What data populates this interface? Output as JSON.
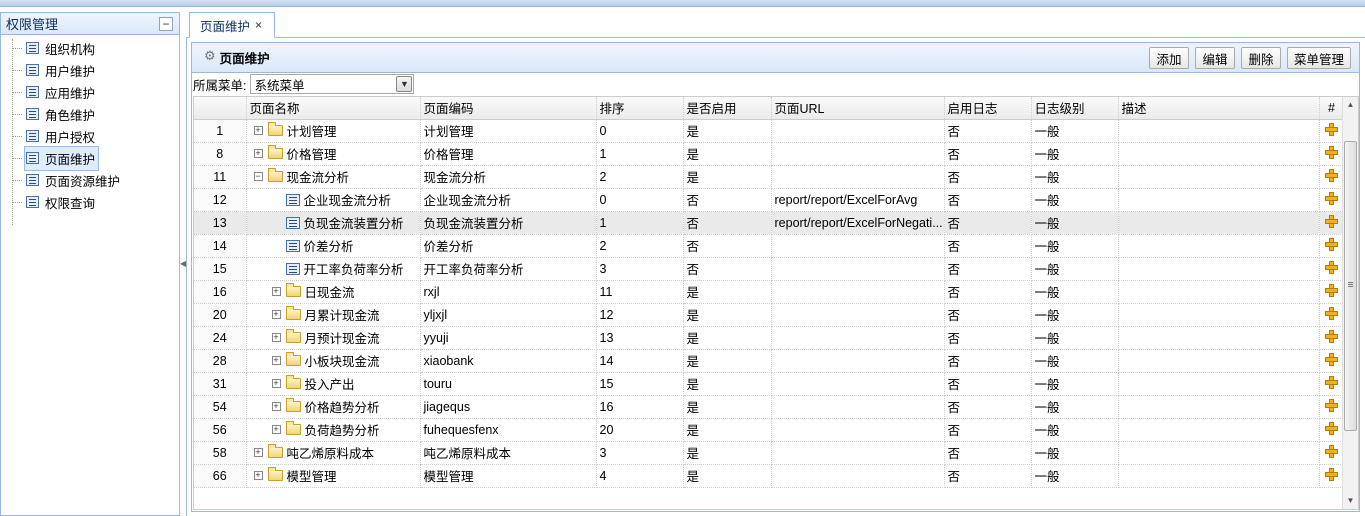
{
  "left": {
    "title": "权限管理",
    "collapse_symbol": "−",
    "items": [
      {
        "label": "组织机构"
      },
      {
        "label": "用户维护"
      },
      {
        "label": "应用维护"
      },
      {
        "label": "角色维护"
      },
      {
        "label": "用户授权"
      },
      {
        "label": "页面维护",
        "selected": true
      },
      {
        "label": "页面资源维护"
      },
      {
        "label": "权限查询"
      }
    ]
  },
  "tabs": [
    {
      "label": "页面维护",
      "close": "×"
    }
  ],
  "panel": {
    "title": "页面维护",
    "buttons": {
      "add": "添加",
      "edit": "编辑",
      "delete": "删除",
      "menu": "菜单管理"
    }
  },
  "filter": {
    "label": "所属菜单:",
    "value": "系统菜单"
  },
  "grid": {
    "columns": [
      "页面名称",
      "页面编码",
      "排序",
      "是否启用",
      "页面URL",
      "启用日志",
      "日志级别",
      "描述",
      "#"
    ],
    "rows": [
      {
        "rn": "1",
        "name": "计划管理",
        "code": "计划管理",
        "order": "0",
        "enabled": "是",
        "url": "",
        "log": "否",
        "level": "一般",
        "desc": "",
        "indent": 0,
        "kind": "folder",
        "exp": "+"
      },
      {
        "rn": "8",
        "name": "价格管理",
        "code": "价格管理",
        "order": "1",
        "enabled": "是",
        "url": "",
        "log": "否",
        "level": "一般",
        "desc": "",
        "indent": 0,
        "kind": "folder",
        "exp": "+"
      },
      {
        "rn": "11",
        "name": "现金流分析",
        "code": "现金流分析",
        "order": "2",
        "enabled": "是",
        "url": "",
        "log": "否",
        "level": "一般",
        "desc": "",
        "indent": 0,
        "kind": "folder",
        "exp": "−"
      },
      {
        "rn": "12",
        "name": "企业现金流分析",
        "code": "企业现金流分析",
        "order": "0",
        "enabled": "否",
        "url": "report/report/ExcelForAvg",
        "log": "否",
        "level": "一般",
        "desc": "",
        "indent": 1,
        "kind": "leaf",
        "exp": ""
      },
      {
        "rn": "13",
        "name": "负现金流装置分析",
        "code": "负现金流装置分析",
        "order": "1",
        "enabled": "否",
        "url": "report/report/ExcelForNegati...",
        "log": "否",
        "level": "一般",
        "desc": "",
        "indent": 1,
        "kind": "leaf",
        "exp": "",
        "hl": true
      },
      {
        "rn": "14",
        "name": "价差分析",
        "code": "价差分析",
        "order": "2",
        "enabled": "否",
        "url": "",
        "log": "否",
        "level": "一般",
        "desc": "",
        "indent": 1,
        "kind": "leaf",
        "exp": ""
      },
      {
        "rn": "15",
        "name": "开工率负荷率分析",
        "code": "开工率负荷率分析",
        "order": "3",
        "enabled": "否",
        "url": "",
        "log": "否",
        "level": "一般",
        "desc": "",
        "indent": 1,
        "kind": "leaf",
        "exp": ""
      },
      {
        "rn": "16",
        "name": "日现金流",
        "code": "rxjl",
        "order": "11",
        "enabled": "是",
        "url": "",
        "log": "否",
        "level": "一般",
        "desc": "",
        "indent": 1,
        "kind": "folder",
        "exp": "+"
      },
      {
        "rn": "20",
        "name": "月累计现金流",
        "code": "yljxjl",
        "order": "12",
        "enabled": "是",
        "url": "",
        "log": "否",
        "level": "一般",
        "desc": "",
        "indent": 1,
        "kind": "folder",
        "exp": "+"
      },
      {
        "rn": "24",
        "name": "月预计现金流",
        "code": "yyuji",
        "order": "13",
        "enabled": "是",
        "url": "",
        "log": "否",
        "level": "一般",
        "desc": "",
        "indent": 1,
        "kind": "folder",
        "exp": "+"
      },
      {
        "rn": "28",
        "name": "小板块现金流",
        "code": "xiaobank",
        "order": "14",
        "enabled": "是",
        "url": "",
        "log": "否",
        "level": "一般",
        "desc": "",
        "indent": 1,
        "kind": "folder",
        "exp": "+"
      },
      {
        "rn": "31",
        "name": "投入产出",
        "code": "touru",
        "order": "15",
        "enabled": "是",
        "url": "",
        "log": "否",
        "level": "一般",
        "desc": "",
        "indent": 1,
        "kind": "folder",
        "exp": "+"
      },
      {
        "rn": "54",
        "name": "价格趋势分析",
        "code": "jiagequs",
        "order": "16",
        "enabled": "是",
        "url": "",
        "log": "否",
        "level": "一般",
        "desc": "",
        "indent": 1,
        "kind": "folder",
        "exp": "+"
      },
      {
        "rn": "56",
        "name": "负荷趋势分析",
        "code": "fuhequesfenx",
        "order": "20",
        "enabled": "是",
        "url": "",
        "log": "否",
        "level": "一般",
        "desc": "",
        "indent": 1,
        "kind": "folder",
        "exp": "+"
      },
      {
        "rn": "58",
        "name": "吨乙烯原料成本",
        "code": "吨乙烯原料成本",
        "order": "3",
        "enabled": "是",
        "url": "",
        "log": "否",
        "level": "一般",
        "desc": "",
        "indent": 0,
        "kind": "folder",
        "exp": "+"
      },
      {
        "rn": "66",
        "name": "模型管理",
        "code": "模型管理",
        "order": "4",
        "enabled": "是",
        "url": "",
        "log": "否",
        "level": "一般",
        "desc": "",
        "indent": 0,
        "kind": "folder",
        "exp": "+"
      }
    ]
  },
  "icons": {
    "gear": "gear-icon",
    "add_row": "plus-icon",
    "page": "page-icon",
    "folder": "folder-icon"
  }
}
